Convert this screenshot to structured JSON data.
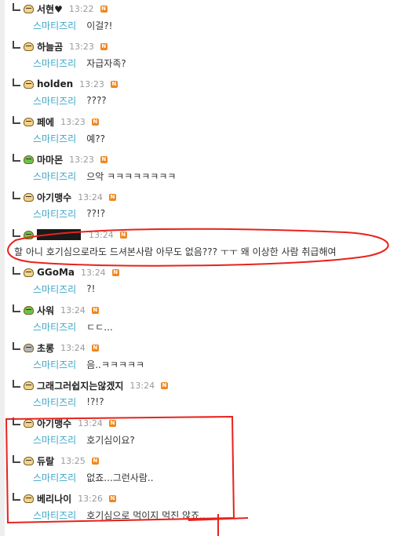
{
  "badge_label": "N",
  "comments": [
    {
      "nick": "서현♥",
      "time": "13:22",
      "mention": "스마티즈리",
      "text": "이걸?!",
      "avatar": "face-icon",
      "avatar_color": "#f3d28a"
    },
    {
      "nick": "하늘곰",
      "time": "13:23",
      "mention": "스마티즈리",
      "text": "자급자족?",
      "avatar": "face-icon",
      "avatar_color": "#f3d28a"
    },
    {
      "nick": "holden",
      "time": "13:23",
      "mention": "스마티즈리",
      "text": "????",
      "avatar": "face-icon",
      "avatar_color": "#f3d28a"
    },
    {
      "nick": "페에",
      "time": "13:23",
      "mention": "스마티즈리",
      "text": "예??",
      "avatar": "face-icon",
      "avatar_color": "#f3d28a"
    },
    {
      "nick": "마마몬",
      "time": "13:23",
      "mention": "스마티즈리",
      "text": "으악 ㅋㅋㅋㅋㅋㅋㅋㅋ",
      "avatar": "frog-icon",
      "avatar_color": "#6cc24a"
    },
    {
      "nick": "아기맹수",
      "time": "13:24",
      "mention": "스마티즈리",
      "text": "??!?",
      "avatar": "face-icon",
      "avatar_color": "#f3d28a"
    },
    {
      "nick": "",
      "time": "13:24",
      "mention": "",
      "text": "할 아니 호기심으로라도 드셔본사람 아무도 없음??? ㅜㅜ 왜 이상한 사람 취급해여",
      "avatar": "frog-icon",
      "avatar_color": "#6cc24a",
      "redacted": true
    },
    {
      "nick": "GGoMa",
      "time": "13:24",
      "mention": "스마티즈리",
      "text": "?!",
      "avatar": "face-icon",
      "avatar_color": "#f3d28a"
    },
    {
      "nick": "사워",
      "time": "13:24",
      "mention": "스마티즈리",
      "text": "ㄷㄷ...",
      "avatar": "frog-icon",
      "avatar_color": "#6cc24a"
    },
    {
      "nick": "초롱",
      "time": "13:24",
      "mention": "스마티즈리",
      "text": "음..ㅋㅋㅋㅋㅋ",
      "avatar": "mouse-icon",
      "avatar_color": "#b7b7b7"
    },
    {
      "nick": "그래그러쉽지는않겠지",
      "time": "13:24",
      "mention": "스마티즈리",
      "text": "!?!?",
      "avatar": "face-icon",
      "avatar_color": "#f3d28a"
    },
    {
      "nick": "아기맹수",
      "time": "13:24",
      "mention": "스마티즈리",
      "text": "호기심이요?",
      "avatar": "face-icon",
      "avatar_color": "#f3d28a"
    },
    {
      "nick": "듀랄",
      "time": "13:25",
      "mention": "스마티즈리",
      "text": "없죠...그런사람..",
      "avatar": "face-icon",
      "avatar_color": "#f3d28a"
    },
    {
      "nick": "베리나이",
      "time": "13:26",
      "mention": "스마티즈리",
      "text": "호기심으로 먹이지 먹진 않죠..",
      "avatar": "face-icon",
      "avatar_color": "#f3d28a"
    }
  ],
  "annotation_color": "#e8221b"
}
